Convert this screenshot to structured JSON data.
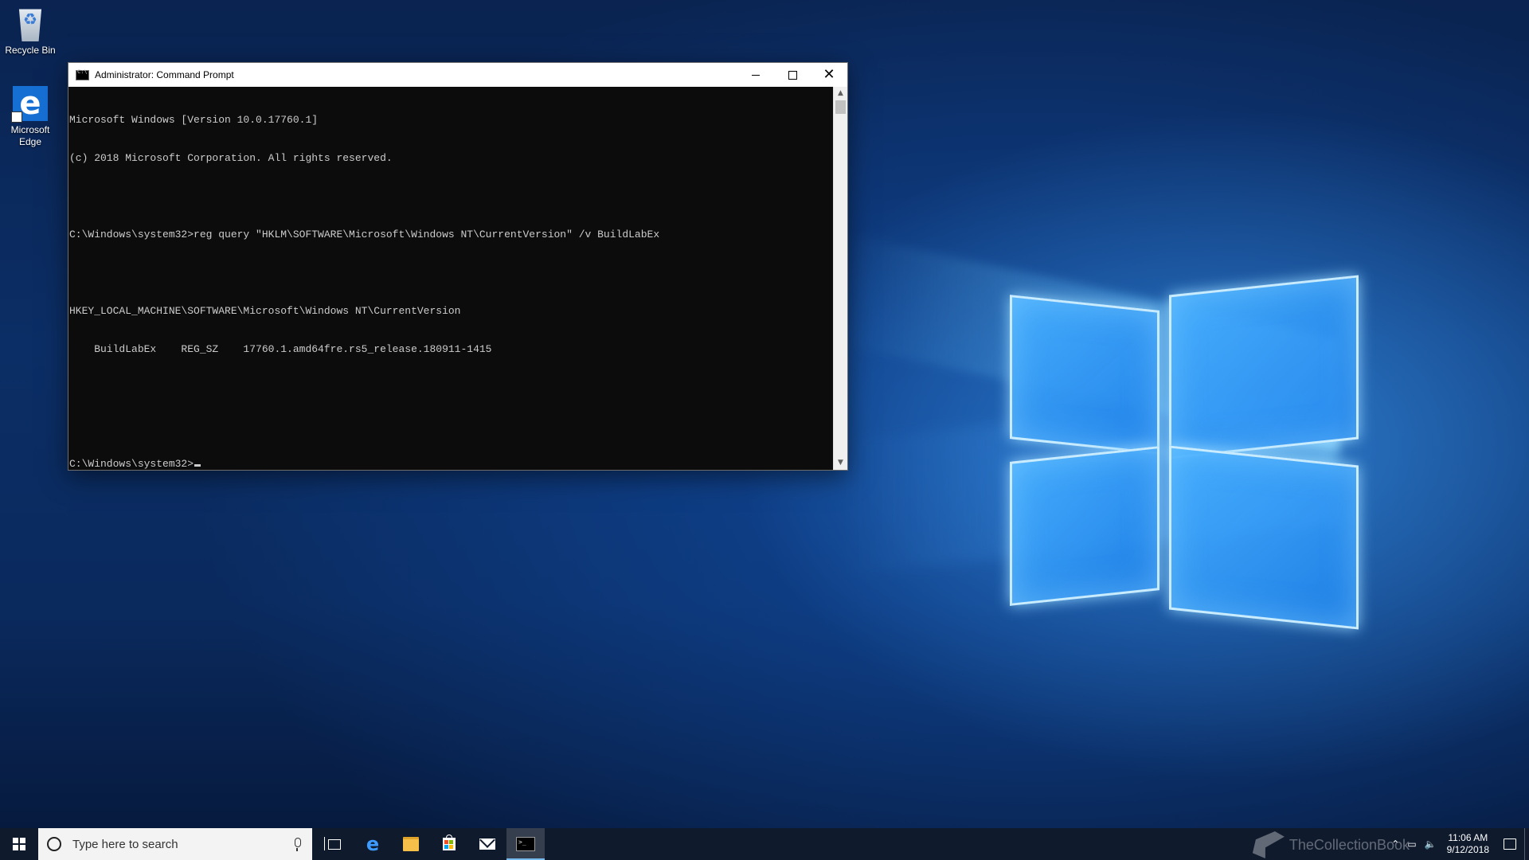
{
  "desktop": {
    "icons": [
      {
        "label": "Recycle Bin",
        "icon": "recycle-bin-icon"
      },
      {
        "label": "Microsoft Edge",
        "icon": "edge-icon"
      }
    ]
  },
  "window": {
    "title": "Administrator: Command Prompt",
    "console_lines": [
      "Microsoft Windows [Version 10.0.17760.1]",
      "(c) 2018 Microsoft Corporation. All rights reserved.",
      "",
      "C:\\Windows\\system32>reg query \"HKLM\\SOFTWARE\\Microsoft\\Windows NT\\CurrentVersion\" /v BuildLabEx",
      "",
      "HKEY_LOCAL_MACHINE\\SOFTWARE\\Microsoft\\Windows NT\\CurrentVersion",
      "    BuildLabEx    REG_SZ    17760.1.amd64fre.rs5_release.180911-1415",
      "",
      "",
      "C:\\Windows\\system32>"
    ]
  },
  "taskbar": {
    "search_placeholder": "Type here to search",
    "pinned": [
      "task-view-icon",
      "edge-icon",
      "file-explorer-icon",
      "store-icon",
      "mail-icon",
      "command-prompt-icon"
    ],
    "clock": {
      "time": "11:06 AM",
      "date": "9/12/2018"
    },
    "accent": "#76b9ed"
  },
  "watermark": {
    "text": "TheCollectionBook"
  }
}
